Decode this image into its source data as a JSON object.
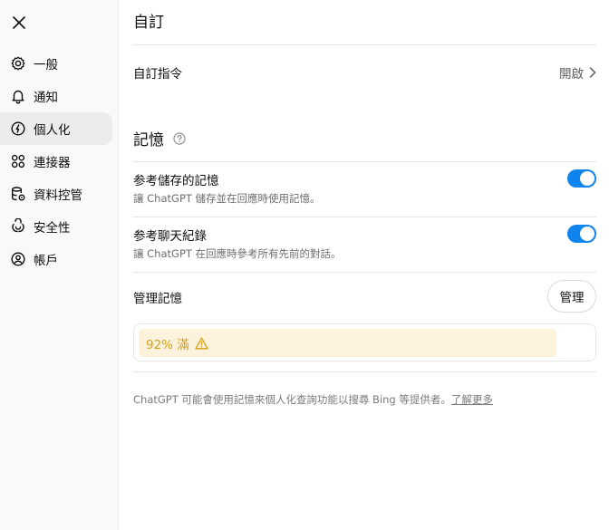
{
  "sidebar": {
    "items": [
      {
        "label": "一般",
        "icon": "gear-icon"
      },
      {
        "label": "通知",
        "icon": "bell-icon"
      },
      {
        "label": "個人化",
        "icon": "personalization-icon",
        "active": true
      },
      {
        "label": "連接器",
        "icon": "connectors-icon"
      },
      {
        "label": "資料控管",
        "icon": "database-gear-icon"
      },
      {
        "label": "安全性",
        "icon": "security-icon"
      },
      {
        "label": "帳戶",
        "icon": "account-icon"
      }
    ]
  },
  "main": {
    "title": "自訂",
    "custom_instructions": {
      "label": "自訂指令",
      "action": "開啟"
    },
    "memory": {
      "title": "記憶",
      "saved_memory": {
        "label": "参考儲存的記憶",
        "description": "讓 ChatGPT 儲存並在回應時使用記憶。",
        "enabled": true
      },
      "chat_history": {
        "label": "参考聊天紀錄",
        "description": "讓 ChatGPT 在回應時參考所有先前的對話。",
        "enabled": true
      },
      "manage": {
        "label": "管理記憶",
        "button": "管理"
      },
      "usage": {
        "text": "92% 滿",
        "percent": 92
      }
    },
    "footnote": {
      "text": "ChatGPT 可能會使用記憶來個人化查詢功能以搜尋 Bing 等提供者。",
      "link": "了解更多"
    }
  },
  "colors": {
    "accent": "#0f84ef",
    "warning_bg": "#fdf3dd",
    "warning_text": "#d79f14"
  }
}
